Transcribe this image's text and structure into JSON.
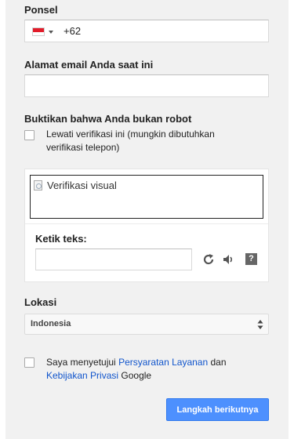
{
  "phone": {
    "label": "Ponsel",
    "country_flag": "indonesia-flag-icon",
    "value": "+62"
  },
  "email": {
    "label": "Alamat email Anda saat ini",
    "value": ""
  },
  "robot": {
    "label": "Buktikan bahwa Anda bukan robot",
    "skip_line1": "Lewati verifikasi ini (mungkin dibutuhkan",
    "skip_line2": "verifikasi telepon)",
    "skip_checked": false
  },
  "captcha": {
    "image_alt": "Verifikasi visual",
    "input_label": "Ketik teks:",
    "input_value": "",
    "icons": [
      "refresh-icon",
      "audio-icon",
      "help-icon"
    ],
    "help_glyph": "?"
  },
  "location": {
    "label": "Lokasi",
    "selected": "Indonesia"
  },
  "terms": {
    "checked": false,
    "prefix": "Saya menyetujui ",
    "tos_link": "Persyaratan Layanan",
    "middle": " dan",
    "privacy_link": "Kebijakan Privasi",
    "suffix": " Google"
  },
  "next_button": {
    "label": "Langkah berikutnya"
  },
  "colors": {
    "panel_bg": "#f1f1f1",
    "link": "#1155cc",
    "primary": "#4d90fe"
  }
}
